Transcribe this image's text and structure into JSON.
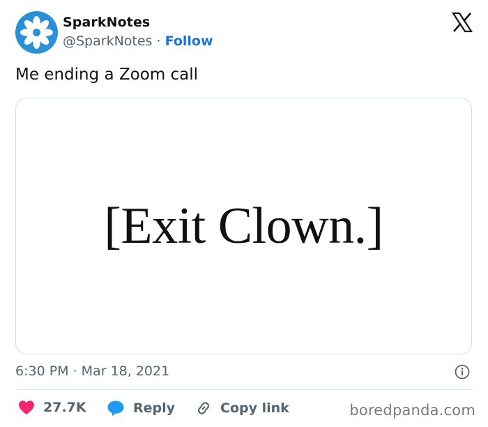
{
  "author": {
    "display_name": "SparkNotes",
    "handle": "@SparkNotes",
    "separator": "·",
    "follow_label": "Follow",
    "avatar_color": "#2a91d8"
  },
  "tweet": {
    "text": "Me ending a Zoom call",
    "media_text": "[Exit Clown.]",
    "timestamp": "6:30 PM · Mar 18, 2021"
  },
  "actions": {
    "likes_count": "27.7K",
    "reply_label": "Reply",
    "copy_link_label": "Copy link"
  },
  "icons": {
    "brand": "x-logo-icon",
    "info": "info-icon",
    "like": "heart-icon",
    "reply": "speech-bubble-icon",
    "copy": "link-icon"
  },
  "colors": {
    "accent": "#1d74d6",
    "like": "#f3266e",
    "reply": "#1d9bf0",
    "muted": "#536471"
  },
  "watermark": "boredpanda.com"
}
